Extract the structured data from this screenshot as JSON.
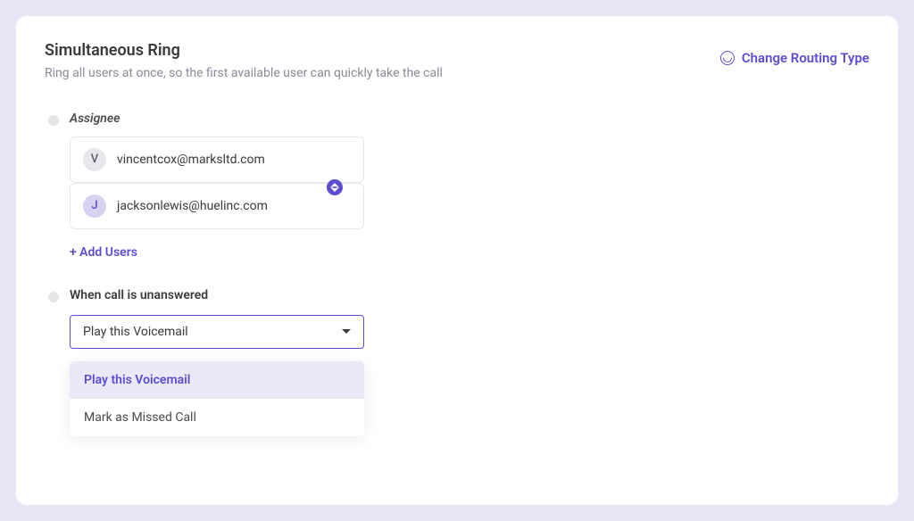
{
  "header": {
    "title": "Simultaneous Ring",
    "description": "Ring all users at once, so the first available user can quickly take the call",
    "change_routing_label": "Change Routing Type"
  },
  "assignee": {
    "label": "Assignee",
    "users": [
      {
        "initial": "V",
        "email": "vincentcox@marksltd.com"
      },
      {
        "initial": "J",
        "email": "jacksonlewis@huelinc.com"
      }
    ],
    "add_users_label": "+ Add Users"
  },
  "unanswered": {
    "label": "When call is unanswered",
    "selected": "Play this Voicemail",
    "options": [
      "Play this Voicemail",
      "Mark as Missed Call"
    ]
  },
  "colors": {
    "accent": "#5b4dd1",
    "background": "#e8e6f5"
  }
}
